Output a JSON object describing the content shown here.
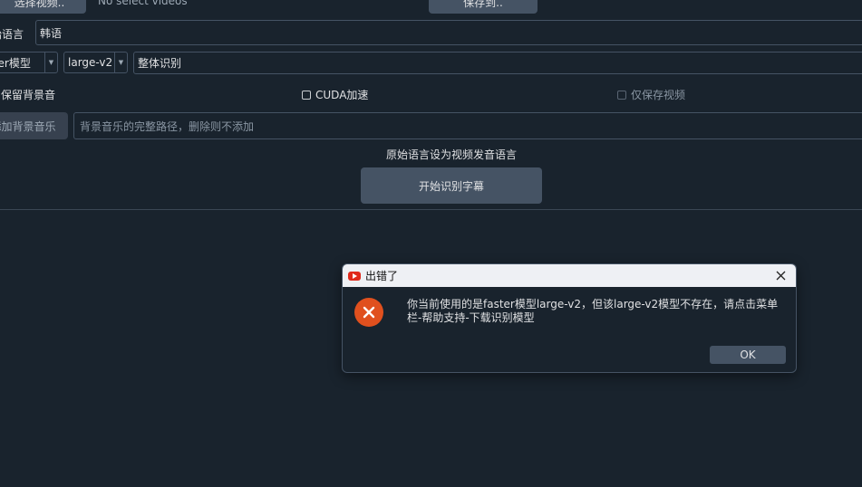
{
  "toolbar": {
    "select_video_label": "选择视频..",
    "no_video_text": "No select videos",
    "save_to_label": "保存到.."
  },
  "form": {
    "source_language_label": "原始语言",
    "source_language_value": "韩语",
    "model_type_value": "faster模型",
    "model_value": "large-v2",
    "recognition_mode_value": "整体识别",
    "keep_bgm_label": "保留背景音",
    "cuda_label": "CUDA加速",
    "save_video_only_label": "仅保存视频",
    "add_bgm_label": "添加背景音乐",
    "bgm_path_placeholder": "背景音乐的完整路径，删除则不添加",
    "hint_text": "原始语言设为视频发音语言",
    "start_button_label": "开始识别字幕"
  },
  "dialog": {
    "title": "出错了",
    "message": "你当前使用的是faster模型large-v2，但该large-v2模型不存在，请点击菜单栏-帮助支持-下载识别模型",
    "ok_label": "OK"
  },
  "colors": {
    "background": "#19232d",
    "button": "#455364",
    "error": "#e0501e",
    "app_icon": "#e02a1c"
  }
}
